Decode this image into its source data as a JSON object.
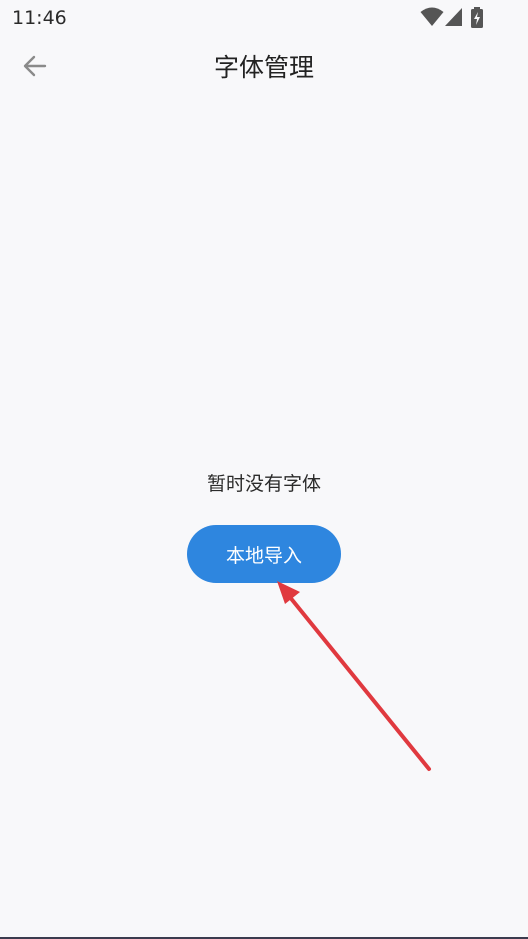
{
  "status_bar": {
    "time": "11:46",
    "icons": [
      "wifi-icon",
      "cellular-signal-icon",
      "battery-charging-icon"
    ]
  },
  "header": {
    "title": "字体管理",
    "back_icon": "arrow-left-icon"
  },
  "main": {
    "empty_message": "暂时没有字体",
    "import_button_label": "本地导入"
  },
  "colors": {
    "background": "#f8f8fa",
    "accent": "#2e86df",
    "annotation_arrow": "#e0393f"
  }
}
